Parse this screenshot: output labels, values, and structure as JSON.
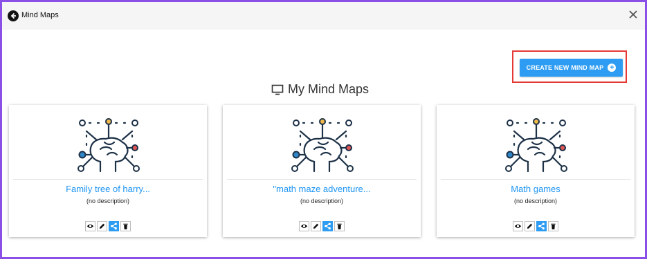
{
  "window": {
    "title": "Mind Maps"
  },
  "toolbar": {
    "create_label": "CREATE NEW MIND MAP"
  },
  "section": {
    "title": "My Mind Maps"
  },
  "cards": [
    {
      "name": "Family tree of harry...",
      "description": "(no description)"
    },
    {
      "name": "\"math maze adventure...",
      "description": "(no description)"
    },
    {
      "name": "Math games",
      "description": "(no description)"
    }
  ],
  "colors": {
    "border": "#8a4fe6",
    "accent": "#2d9cf2",
    "highlight": "#e53935",
    "node_blue": "#2f86c8",
    "node_yellow": "#f0b94b",
    "node_red": "#e05555",
    "line": "#1d3147"
  },
  "icons": {
    "back": "arrow-left-circle-icon",
    "close": "close-icon",
    "create": "plus-circle-icon",
    "section": "monitor-icon",
    "view": "eye-icon",
    "edit": "pencil-icon",
    "share": "share-icon",
    "delete": "trash-icon"
  }
}
